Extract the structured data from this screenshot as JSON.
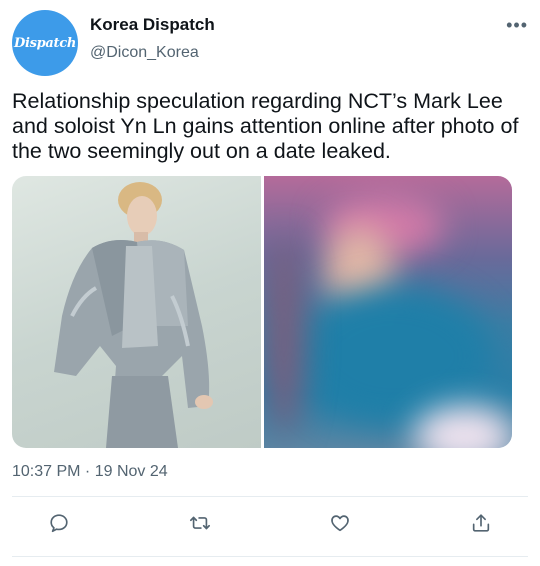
{
  "account": {
    "avatar_text": "Dispatch",
    "name": "Korea Dispatch",
    "handle": "@Dicon_Korea",
    "avatar_color": "#3d9be9"
  },
  "more_label": "•••",
  "tweet": {
    "text": "Relationship speculation regarding NCT’s Mark Lee and soloist Yn Ln gains attention online after photo of the two seemingly out on a date leaked.",
    "timestamp": "10:37 PM · 19 Nov 24"
  },
  "media": [
    {
      "alt": "photo-left",
      "icon": "photo"
    },
    {
      "alt": "photo-right-blurred",
      "icon": "photo"
    }
  ],
  "actions": [
    {
      "icon": "reply-icon"
    },
    {
      "icon": "retweet-icon"
    },
    {
      "icon": "like-icon"
    },
    {
      "icon": "share-icon"
    }
  ],
  "colors": {
    "text": "#0f1419",
    "secondary": "#536471",
    "divider": "#e6ecf0"
  }
}
